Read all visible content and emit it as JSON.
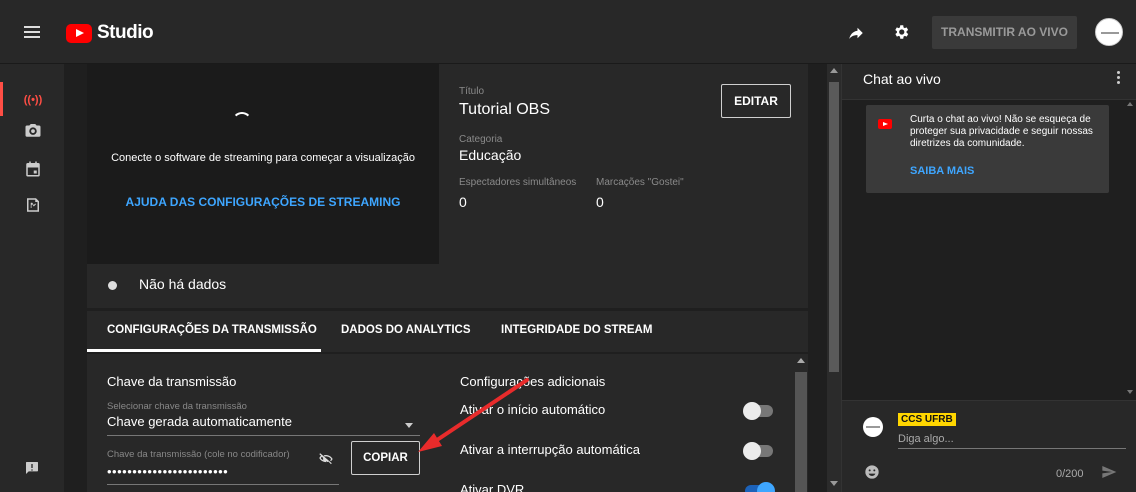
{
  "topbar": {
    "logo_text": "Studio",
    "go_live_label": "TRANSMITIR AO VIVO"
  },
  "preview": {
    "message": "Conecte o software de streaming para começar a visualização",
    "help_link": "AJUDA DAS CONFIGURAÇÕES DE STREAMING"
  },
  "info": {
    "title_label": "Título",
    "title_value": "Tutorial OBS",
    "edit_label": "EDITAR",
    "category_label": "Categoria",
    "category_value": "Educação",
    "viewers_label": "Espectadores simultâneos",
    "viewers_value": "0",
    "likes_label": "Marcações \"Gostei\"",
    "likes_value": "0"
  },
  "status": {
    "nodata_text": "Não há dados"
  },
  "tabs": [
    {
      "label": "CONFIGURAÇÕES DA TRANSMISSÃO",
      "active": true
    },
    {
      "label": "DADOS DO ANALYTICS",
      "active": false
    },
    {
      "label": "INTEGRIDADE DO STREAM",
      "active": false
    }
  ],
  "stream_settings": {
    "key_section_title": "Chave da transmissão",
    "select_key_label": "Selecionar chave da transmissão",
    "select_key_value": "Chave gerada automaticamente",
    "key_field_label": "Chave da transmissão (cole no codificador)",
    "key_field_value": "••••••••••••••••••••••••",
    "copy_label": "COPIAR",
    "extra_section_title": "Configurações adicionais",
    "toggles": [
      {
        "label": "Ativar o início automático",
        "on": false
      },
      {
        "label": "Ativar a interrupção automática",
        "on": false
      },
      {
        "label": "Ativar DVR",
        "on": true
      }
    ]
  },
  "chat": {
    "title": "Chat ao vivo",
    "notice_text": "Curta o chat ao vivo! Não se esqueça de proteger sua privacidade e seguir nossas diretrizes da comunidade.",
    "notice_link": "SAIBA MAIS",
    "user_badge": "CCS UFRB",
    "input_placeholder": "Diga algo...",
    "char_count": "0/200"
  },
  "colors": {
    "accent_blue": "#3ea6ff",
    "live_red": "#ff4e45",
    "badge_yellow": "#ffd600",
    "annotation_arrow": "#e82b2b"
  }
}
